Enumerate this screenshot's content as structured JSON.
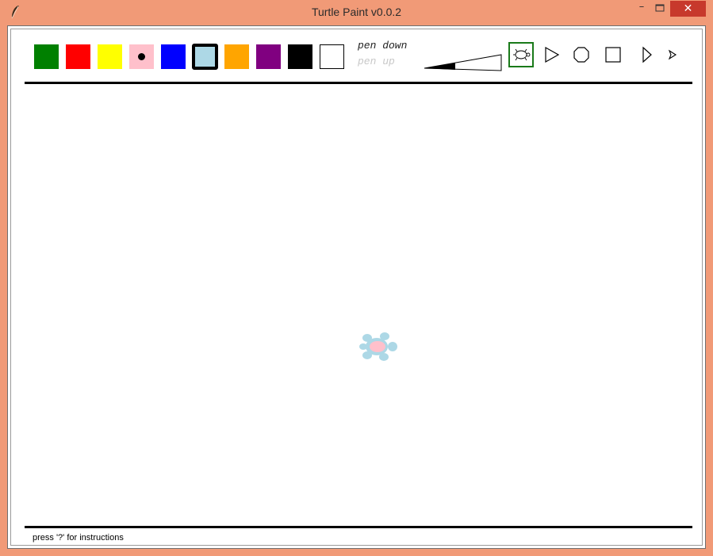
{
  "window": {
    "title": "Turtle Paint v0.0.2",
    "minimize_glyph": "–",
    "close_glyph": "✕"
  },
  "palette": {
    "selected_pen_color": "pink",
    "selected_fill_color": "lightblue",
    "colors": [
      {
        "name": "green",
        "hex": "#008000"
      },
      {
        "name": "red",
        "hex": "#ff0000"
      },
      {
        "name": "yellow",
        "hex": "#ffff00"
      },
      {
        "name": "pink",
        "hex": "#ffc0cb"
      },
      {
        "name": "blue",
        "hex": "#0000ff"
      },
      {
        "name": "lightblue",
        "hex": "#add8e6"
      },
      {
        "name": "orange",
        "hex": "#ffa500"
      },
      {
        "name": "purple",
        "hex": "#800080"
      },
      {
        "name": "black",
        "hex": "#000000"
      },
      {
        "name": "white",
        "hex": "#ffffff"
      }
    ]
  },
  "pen": {
    "down_label": "pen down",
    "up_label": "pen up",
    "state": "down"
  },
  "shapes": {
    "selected": "turtle",
    "items": [
      "turtle",
      "triangle",
      "circle",
      "square",
      "classic",
      "arrow"
    ]
  },
  "status": {
    "hint": "press '?' for instructions"
  }
}
